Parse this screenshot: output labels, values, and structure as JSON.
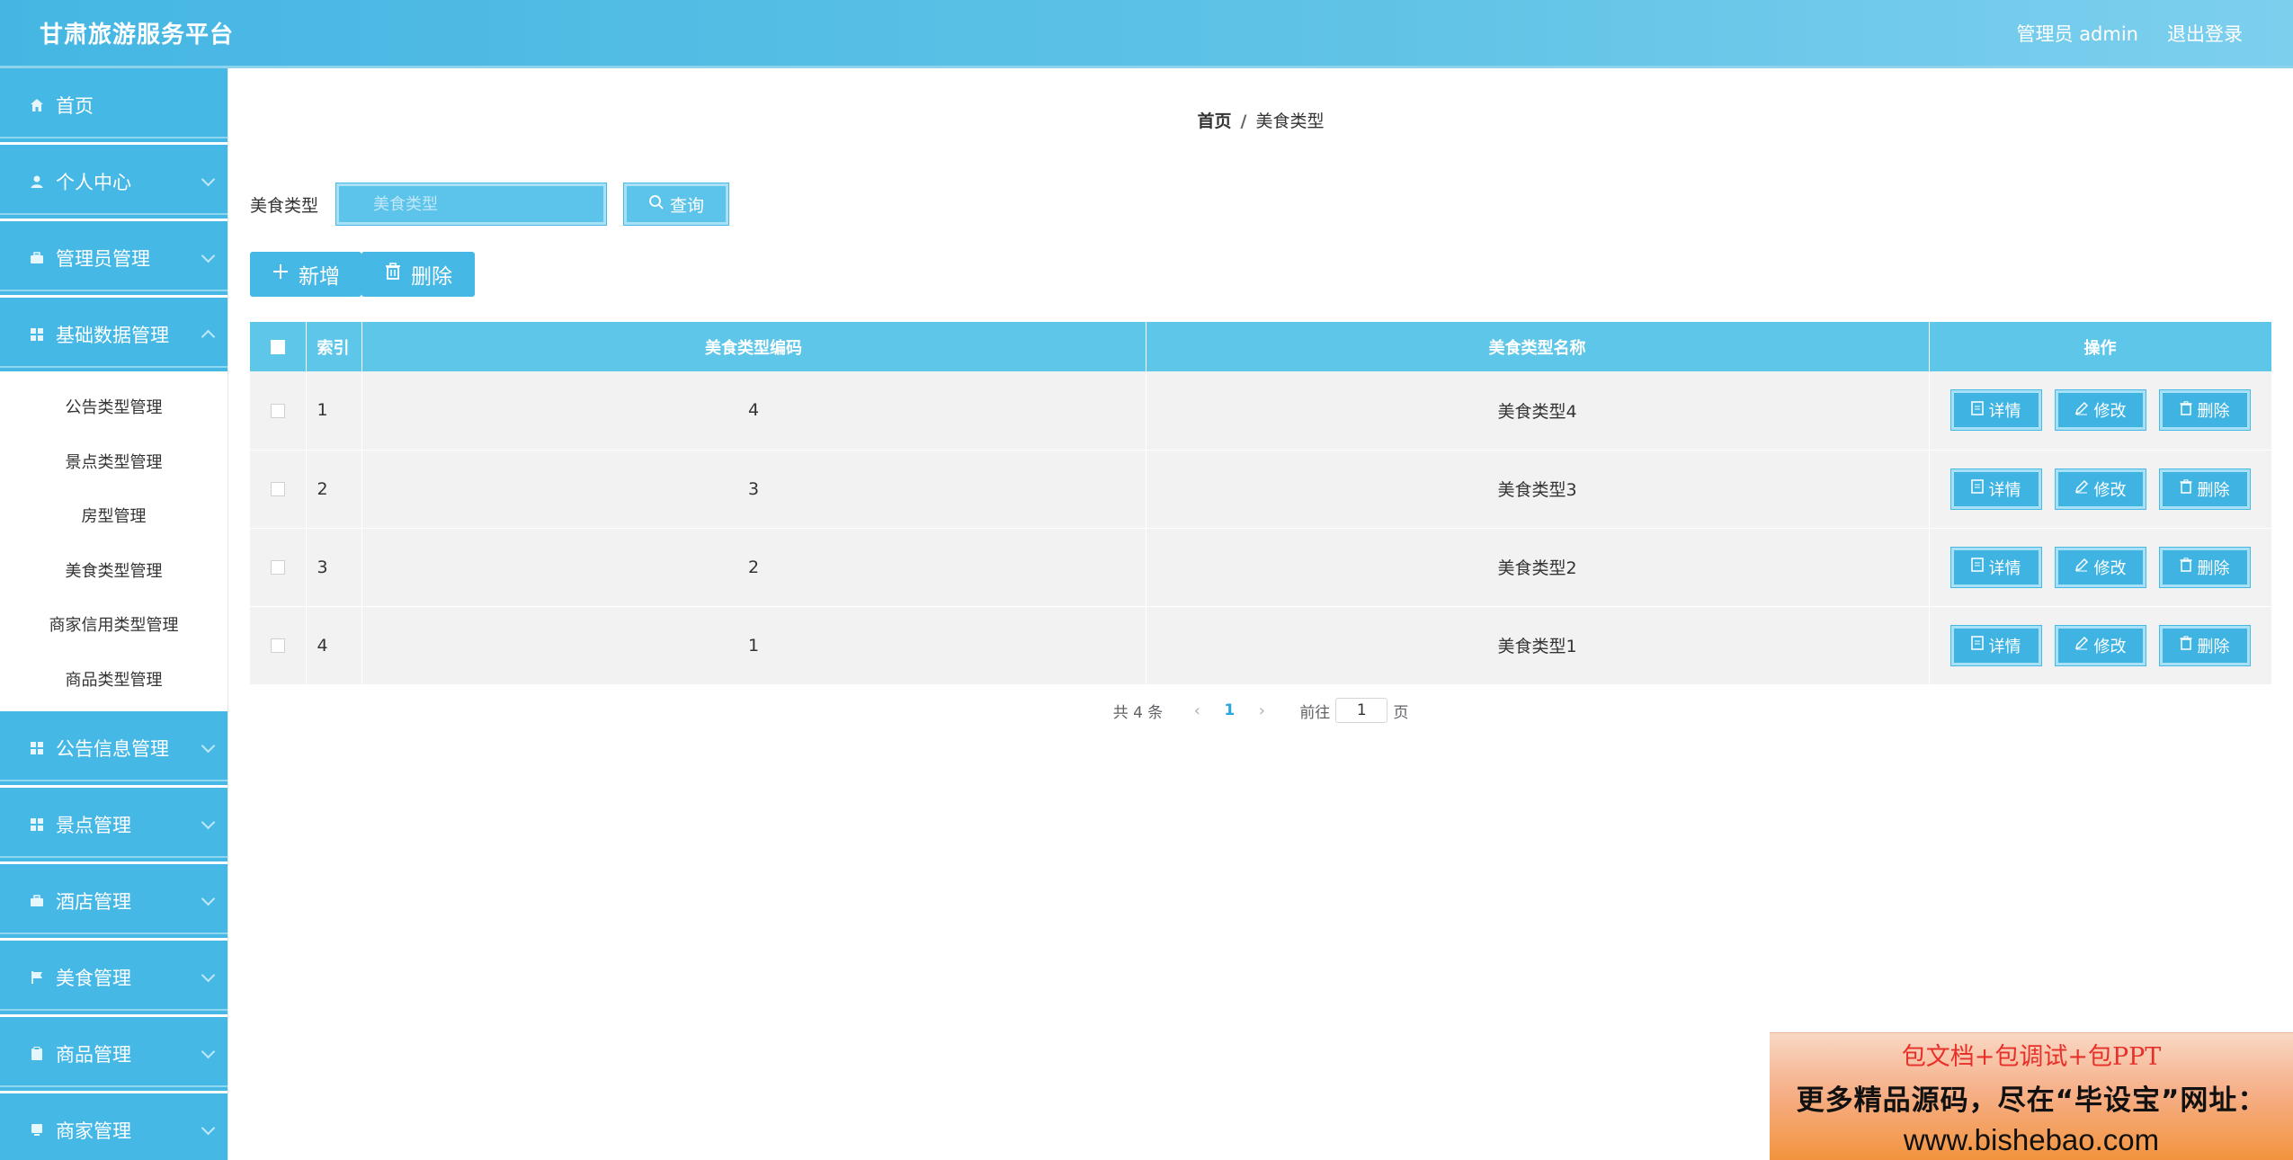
{
  "header": {
    "app_title": "甘肃旅游服务平台",
    "user_label": "管理员 admin",
    "logout_label": "退出登录"
  },
  "sidebar": {
    "menu": [
      {
        "label": "首页",
        "icon": "home-icon"
      },
      {
        "label": "个人中心",
        "icon": "user-icon"
      },
      {
        "label": "管理员管理",
        "icon": "briefcase-icon"
      },
      {
        "label": "基础数据管理",
        "icon": "grid-icon"
      },
      {
        "label": "公告信息管理",
        "icon": "grid-icon"
      },
      {
        "label": "景点管理",
        "icon": "grid-icon"
      },
      {
        "label": "酒店管理",
        "icon": "briefcase-icon"
      },
      {
        "label": "美食管理",
        "icon": "flag-icon"
      },
      {
        "label": "商品管理",
        "icon": "clipboard-icon"
      },
      {
        "label": "商家管理",
        "icon": "monitor-icon"
      }
    ],
    "submenu": [
      "公告类型管理",
      "景点类型管理",
      "房型管理",
      "美食类型管理",
      "商家信用类型管理",
      "商品类型管理"
    ]
  },
  "breadcrumb": {
    "home": "首页",
    "separator": "/",
    "current": "美食类型"
  },
  "search": {
    "label": "美食类型",
    "placeholder": "美食类型",
    "button": "查询"
  },
  "actions": {
    "add": "新增",
    "delete": "删除"
  },
  "table": {
    "columns": [
      "索引",
      "美食类型编码",
      "美食类型名称",
      "操作"
    ],
    "rows": [
      {
        "index": "1",
        "code": "4",
        "name": "美食类型4"
      },
      {
        "index": "2",
        "code": "3",
        "name": "美食类型3"
      },
      {
        "index": "3",
        "code": "2",
        "name": "美食类型2"
      },
      {
        "index": "4",
        "code": "1",
        "name": "美食类型1"
      }
    ],
    "row_actions": {
      "detail": "详情",
      "edit": "修改",
      "delete": "删除"
    }
  },
  "pagination": {
    "total": "共 4 条",
    "current_page": "1",
    "goto_prefix": "前往",
    "goto_value": "1",
    "goto_suffix": "页"
  },
  "ad": {
    "line1": "包文档+包调试+包PPT",
    "line2": "更多精品源码，尽在“毕设宝”网址：",
    "line3": "www.bishebao.com"
  },
  "colors": {
    "primary": "#46b8e6",
    "header": "#4fbde6",
    "row_bg": "#f2f2f2",
    "ad_text_red": "#e8302a"
  }
}
